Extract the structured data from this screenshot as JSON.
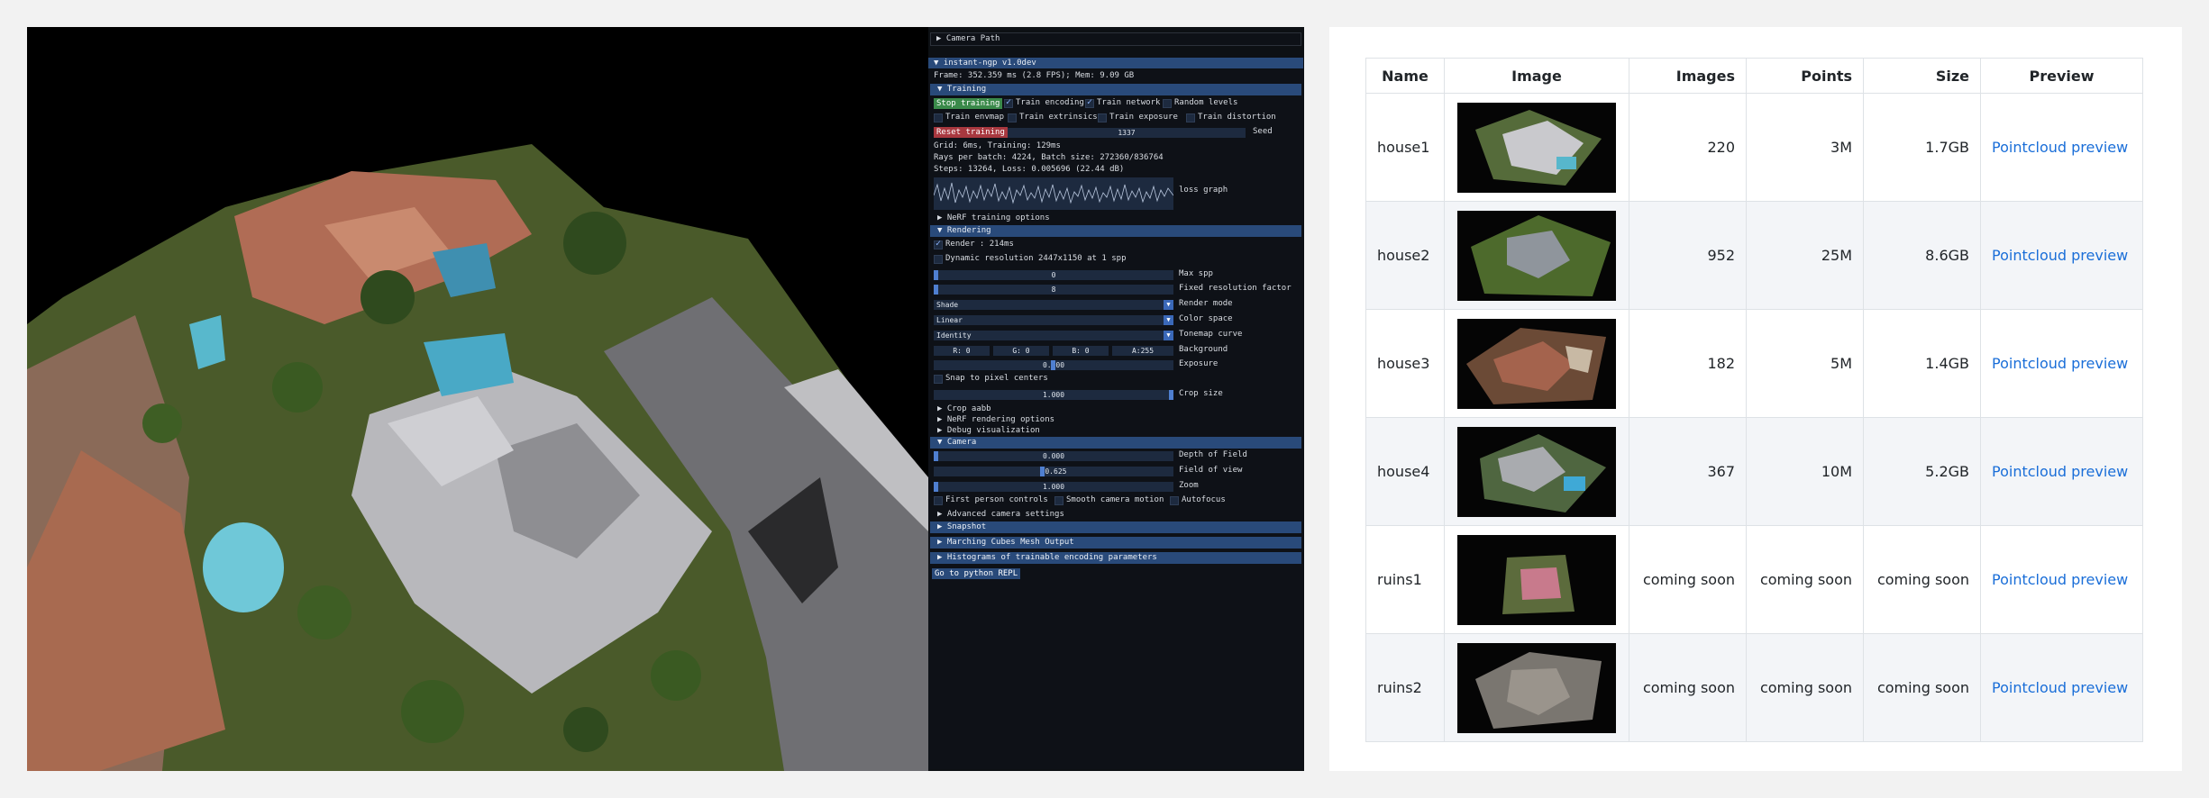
{
  "gui": {
    "camera_path": "▶ Camera Path",
    "main_title": "▼ instant-ngp v1.0dev",
    "frame_info": "Frame: 352.359 ms (2.8 FPS); Mem: 9.09 GB",
    "training_header": "▼ Training",
    "stop_training": "Stop training",
    "train_encoding": "Train encoding",
    "train_network": "Train network",
    "random_levels": "Random levels",
    "train_envmap": "Train envmap",
    "train_extrinsics": "Train extrinsics",
    "train_exposure": "Train exposure",
    "train_distortion": "Train distortion",
    "reset_training": "Reset training",
    "seed_value": "1337",
    "seed_label": "Seed",
    "grid_info": "Grid: 6ms, Training: 129ms",
    "rays_info": "Rays per batch: 4224, Batch size: 272360/836764",
    "steps_info": "Steps: 13264, Loss: 0.005696 (22.44 dB)",
    "loss_graph": "loss graph",
    "nerf_training_options": "▶ NeRF training options",
    "rendering_header": "▼ Rendering",
    "render": "Render : 214ms",
    "dynamic_resolution": "Dynamic resolution 2447x1150 at 1 spp",
    "max_spp_value": "0",
    "max_spp_label": "Max spp",
    "fixed_res_value": "8",
    "fixed_res_label": "Fixed resolution factor",
    "render_mode_value": "Shade",
    "render_mode_label": "Render mode",
    "color_space_value": "Linear",
    "color_space_label": "Color space",
    "tonemap_value": "Identity",
    "tonemap_label": "Tonemap curve",
    "bg_r": "R:  0",
    "bg_g": "G:  0",
    "bg_b": "B:  0",
    "bg_a": "A:255",
    "background_label": "Background",
    "exposure_value": "0.000",
    "exposure_label": "Exposure",
    "snap_pixel": "Snap to pixel centers",
    "crop_size_value": "1.000",
    "crop_size_label": "Crop size",
    "crop_aabb": "▶ Crop aabb",
    "nerf_rendering_options": "▶ NeRF rendering options",
    "debug_vis": "▶ Debug visualization",
    "camera_header": "▼ Camera",
    "dof_value": "0.000",
    "dof_label": "Depth of Field",
    "fov_value": "50.625",
    "fov_label": "Field of view",
    "zoom_value": "1.000",
    "zoom_label": "Zoom",
    "first_person": "First person controls",
    "smooth_camera": "Smooth camera motion",
    "autofocus": "Autofocus",
    "advanced_camera": "▶ Advanced camera settings",
    "snapshot": "▶ Snapshot",
    "marching_cubes": "▶ Marching Cubes Mesh Output",
    "histograms": "▶ Histograms of trainable encoding parameters",
    "python_repl": "Go to python REPL"
  },
  "table": {
    "headers": [
      "Name",
      "Image",
      "Images",
      "Points",
      "Size",
      "Preview"
    ],
    "rows": [
      {
        "name": "house1",
        "images": "220",
        "points": "3M",
        "size": "1.7GB",
        "preview": "Pointcloud preview"
      },
      {
        "name": "house2",
        "images": "952",
        "points": "25M",
        "size": "8.6GB",
        "preview": "Pointcloud preview"
      },
      {
        "name": "house3",
        "images": "182",
        "points": "5M",
        "size": "1.4GB",
        "preview": "Pointcloud preview"
      },
      {
        "name": "house4",
        "images": "367",
        "points": "10M",
        "size": "5.2GB",
        "preview": "Pointcloud preview"
      },
      {
        "name": "ruins1",
        "images": "coming soon",
        "points": "coming soon",
        "size": "coming soon",
        "preview": "Pointcloud preview"
      },
      {
        "name": "ruins2",
        "images": "coming soon",
        "points": "coming soon",
        "size": "coming soon",
        "preview": "Pointcloud preview"
      }
    ]
  },
  "colors": {
    "header_blue": "#294a7a",
    "stop_green": "#3a8a4a",
    "reset_red": "#a8383f",
    "link_blue": "#1a6ed8"
  }
}
